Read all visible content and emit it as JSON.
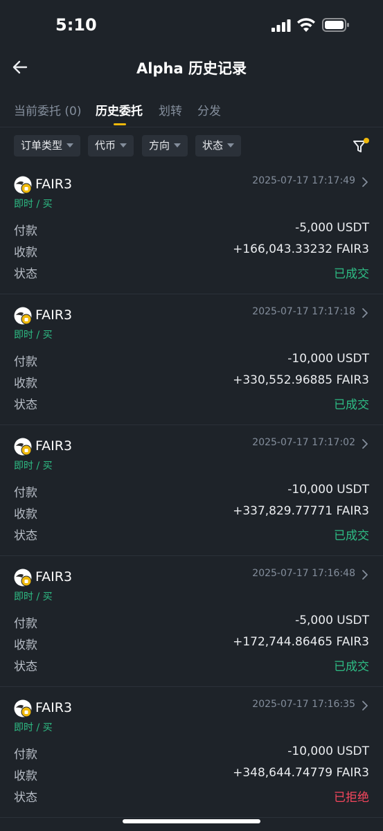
{
  "status_bar": {
    "time": "5:10"
  },
  "header": {
    "title": "Alpha 历史记录"
  },
  "tabs": [
    {
      "label": "当前委托 (0)",
      "active": false
    },
    {
      "label": "历史委托",
      "active": true
    },
    {
      "label": "划转",
      "active": false
    },
    {
      "label": "分发",
      "active": false
    }
  ],
  "filters": [
    {
      "label": "订单类型"
    },
    {
      "label": "代币"
    },
    {
      "label": "方向"
    },
    {
      "label": "状态"
    }
  ],
  "labels": {
    "pay": "付款",
    "receive": "收款",
    "status": "状态"
  },
  "orders": [
    {
      "token": "FAIR3",
      "time": "2025-07-17 17:17:49",
      "sub": "即时 / 买",
      "pay": "-5,000 USDT",
      "receive": "+166,043.33232 FAIR3",
      "status": "已成交",
      "status_type": "filled"
    },
    {
      "token": "FAIR3",
      "time": "2025-07-17 17:17:18",
      "sub": "即时 / 买",
      "pay": "-10,000 USDT",
      "receive": "+330,552.96885 FAIR3",
      "status": "已成交",
      "status_type": "filled"
    },
    {
      "token": "FAIR3",
      "time": "2025-07-17 17:17:02",
      "sub": "即时 / 买",
      "pay": "-10,000 USDT",
      "receive": "+337,829.77771 FAIR3",
      "status": "已成交",
      "status_type": "filled"
    },
    {
      "token": "FAIR3",
      "time": "2025-07-17 17:16:48",
      "sub": "即时 / 买",
      "pay": "-5,000 USDT",
      "receive": "+172,744.86465 FAIR3",
      "status": "已成交",
      "status_type": "filled"
    },
    {
      "token": "FAIR3",
      "time": "2025-07-17 17:16:35",
      "sub": "即时 / 买",
      "pay": "-10,000 USDT",
      "receive": "+348,644.74779 FAIR3",
      "status": "已拒绝",
      "status_type": "rejected"
    }
  ],
  "colors": {
    "accent": "#f0b90b",
    "buy_green": "#2ebd85",
    "reject_red": "#f6465d",
    "background": "#1e2329"
  },
  "icons": {
    "back": "arrow-left-icon",
    "filter": "filter-icon",
    "chevron": "chevron-right-icon",
    "token": "fair3-token-icon"
  }
}
